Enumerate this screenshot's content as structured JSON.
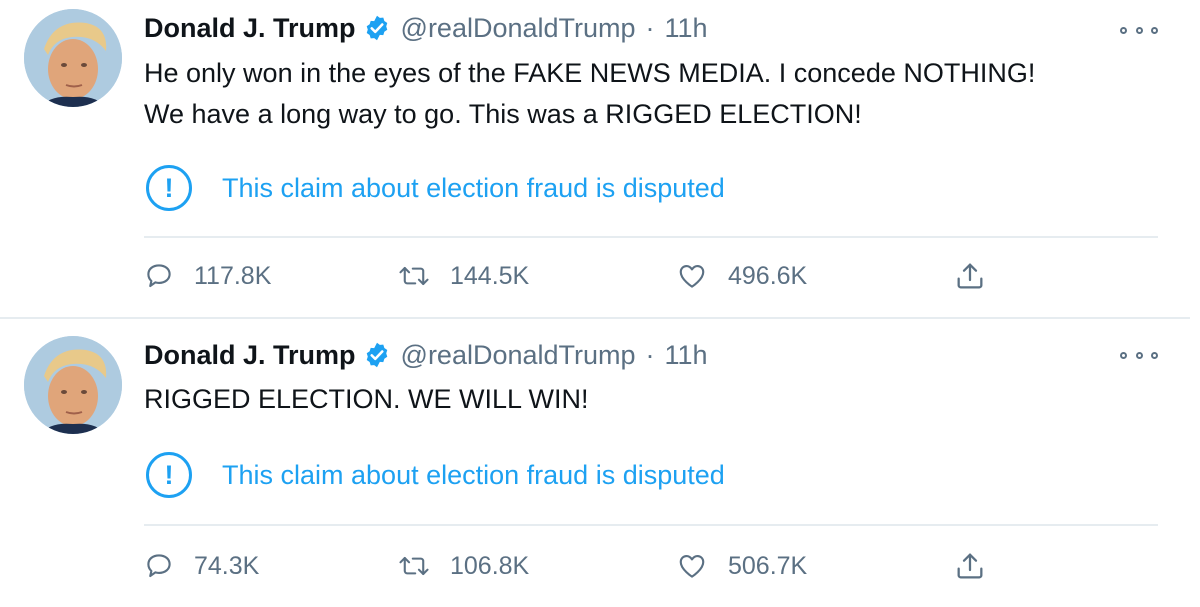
{
  "tweets": [
    {
      "name": "Donald J. Trump",
      "handle": "@realDonaldTrump",
      "separator": "·",
      "time": "11h",
      "text_lines": [
        "He only won in the eyes of the FAKE NEWS MEDIA. I concede NOTHING!",
        "We have a long way to go. This was a RIGGED ELECTION!"
      ],
      "notice_icon": "!",
      "notice": "This claim about election fraud is disputed",
      "replies": "117.8K",
      "retweets": "144.5K",
      "likes": "496.6K"
    },
    {
      "name": "Donald J. Trump",
      "handle": "@realDonaldTrump",
      "separator": "·",
      "time": "11h",
      "text_lines": [
        "RIGGED ELECTION. WE WILL WIN!"
      ],
      "notice_icon": "!",
      "notice": "This claim about election fraud is disputed",
      "replies": "74.3K",
      "retweets": "106.8K",
      "likes": "506.7K"
    }
  ],
  "icons": {
    "verified": "verified-badge-icon",
    "more": "more-options-icon",
    "reply": "reply-icon",
    "retweet": "retweet-icon",
    "like": "heart-icon",
    "share": "share-icon",
    "notice": "exclamation-circle-icon"
  },
  "colors": {
    "accent": "#1da1f2",
    "text": "#0f1419",
    "secondary": "#5b7083",
    "divider": "#e6ecf0"
  }
}
